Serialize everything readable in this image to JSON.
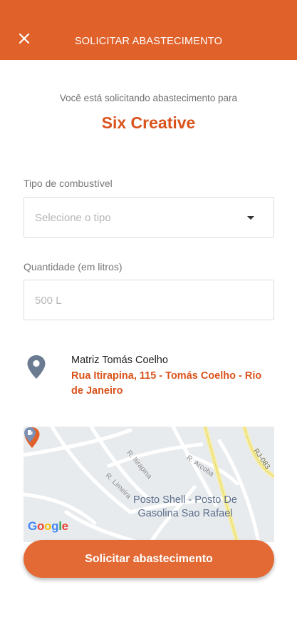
{
  "header": {
    "title": "SOLICITAR ABASTECIMENTO",
    "close_icon": "close-icon"
  },
  "intro": {
    "text": "Você está solicitando abastecimento para",
    "company": "Six Creative"
  },
  "fuel": {
    "label": "Tipo de combustível",
    "placeholder": "Selecione o tipo"
  },
  "quantity": {
    "label": "Quantidade (em litros)",
    "placeholder": "500 L"
  },
  "address": {
    "icon": "location-pin-icon",
    "name": "Matriz Tomás Coelho",
    "line": "Rua Itirapina, 115 - Tomás Coelho - Rio de Janeiro"
  },
  "map": {
    "streets": [
      "R. Itirapina",
      "R. Limeira",
      "R. Arcoba",
      "RJ-083"
    ],
    "poi": "Posto Shell - Posto De Gasolina Sao Rafael",
    "brand": "Google",
    "brand_colors": [
      "#4285F4",
      "#EA4335",
      "#FBBC05",
      "#4285F4",
      "#34A853",
      "#EA4335"
    ]
  },
  "submit": {
    "label": "Solicitar abastecimento"
  },
  "colors": {
    "header": "#e0612a",
    "accent": "#d9531c",
    "button": "#e36a34"
  }
}
